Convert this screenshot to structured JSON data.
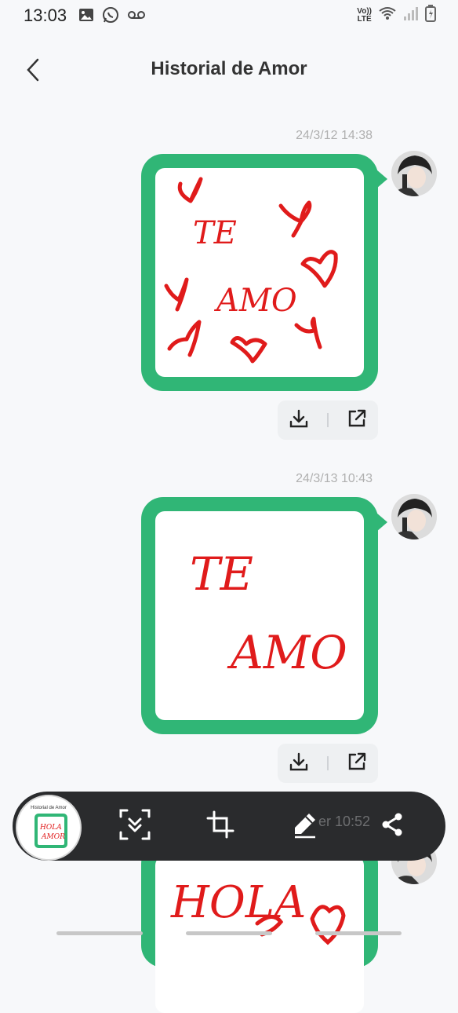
{
  "status_bar": {
    "time": "13:03",
    "volte_top": "Vo))",
    "volte_bottom": "LTE"
  },
  "header": {
    "title": "Historial de Amor"
  },
  "messages": [
    {
      "timestamp": "24/3/12 14:38",
      "drawing_text": "TE AMO",
      "ink_color": "#e01b1b"
    },
    {
      "timestamp": "24/3/13 10:43",
      "drawing_text": "TE AMO",
      "ink_color": "#e01b1b"
    }
  ],
  "partial_message": {
    "drawing_text": "HOLA AMOR",
    "ink_color": "#e01b1b"
  },
  "toolbar": {
    "thumbnail_title": "Historial de Amor",
    "thumbnail_drawing_text": "HOLA AMOR",
    "ghost_timestamp": "er 10:52",
    "icons": [
      "scroll-capture-icon",
      "crop-icon",
      "pen-icon",
      "share-icon"
    ]
  },
  "colors": {
    "bubble": "#30b676",
    "toolbar": "#2a2b2d",
    "background": "#f7f8fa"
  }
}
